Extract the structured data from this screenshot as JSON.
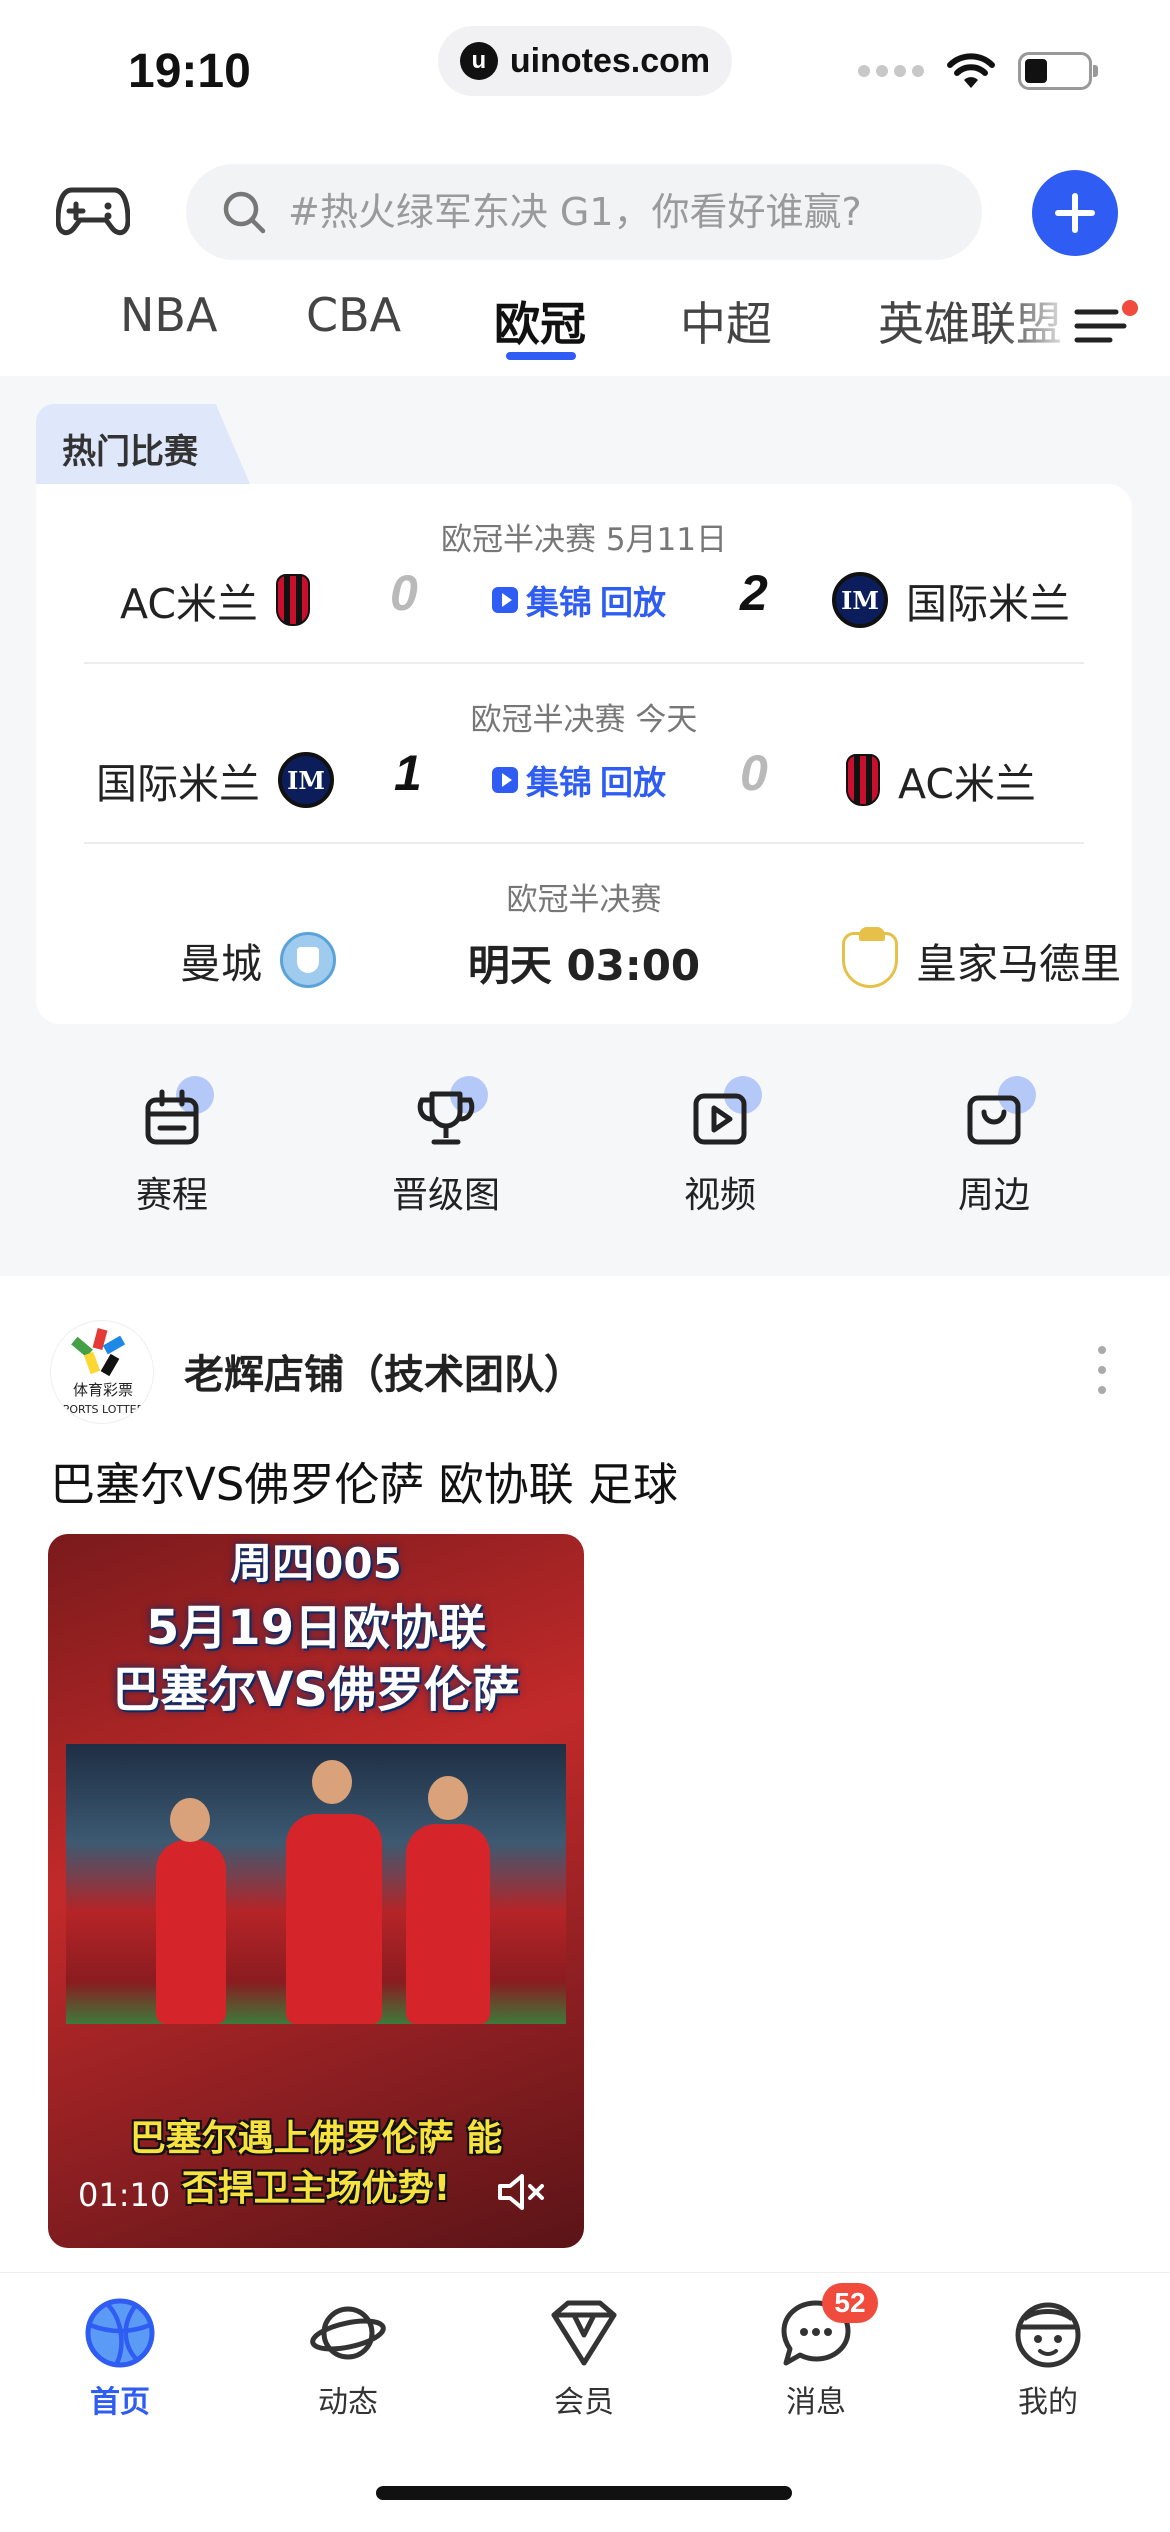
{
  "status_bar": {
    "time": "19:10",
    "url": "uinotes.com"
  },
  "search": {
    "placeholder": "#热火绿军东决 G1，你看好谁赢?"
  },
  "tabs": [
    {
      "label": "NBA"
    },
    {
      "label": "CBA"
    },
    {
      "label": "欧冠",
      "active": true
    },
    {
      "label": "中超"
    },
    {
      "label": "英雄联盟"
    }
  ],
  "hot": {
    "title": "热门比赛",
    "matches": [
      {
        "meta": "欧冠半决赛  5月11日",
        "home": "AC米兰",
        "home_score": "0",
        "away_score": "2",
        "away": "国际米兰",
        "highlight": "集锦",
        "replay": "回放"
      },
      {
        "meta": "欧冠半决赛  今天",
        "home": "国际米兰",
        "home_score": "1",
        "away_score": "0",
        "away": "AC米兰",
        "highlight": "集锦",
        "replay": "回放"
      },
      {
        "meta": "欧冠半决赛",
        "home": "曼城",
        "kickoff": "明天 03:00",
        "away": "皇家马德里"
      }
    ]
  },
  "quick_nav": [
    {
      "label": "赛程",
      "icon": "calendar-icon"
    },
    {
      "label": "晋级图",
      "icon": "trophy-icon"
    },
    {
      "label": "视频",
      "icon": "video-icon"
    },
    {
      "label": "周边",
      "icon": "shopping-bag-icon"
    }
  ],
  "post": {
    "author": "老辉店铺（技术团队）",
    "title": "巴塞尔VS佛罗伦萨 欧协联 足球",
    "video": {
      "line1": "周四005",
      "line2": "5月19日欧协联",
      "line3": "巴塞尔VS佛罗伦萨",
      "caption1": "巴塞尔遇上佛罗伦萨 能",
      "caption2": "否捍卫主场优势!",
      "duration": "01:10"
    },
    "avatar_text": "体育彩票"
  },
  "bottom_nav": [
    {
      "label": "首页",
      "icon": "basketball-icon",
      "active": true
    },
    {
      "label": "动态",
      "icon": "planet-icon"
    },
    {
      "label": "会员",
      "icon": "diamond-icon"
    },
    {
      "label": "消息",
      "icon": "chat-bubble-icon",
      "badge": "52"
    },
    {
      "label": "我的",
      "icon": "profile-face-icon"
    }
  ],
  "colors": {
    "accent": "#2f5cf2",
    "badge": "#f04b3c",
    "hot_tag_bg": "#dfe8fa"
  }
}
